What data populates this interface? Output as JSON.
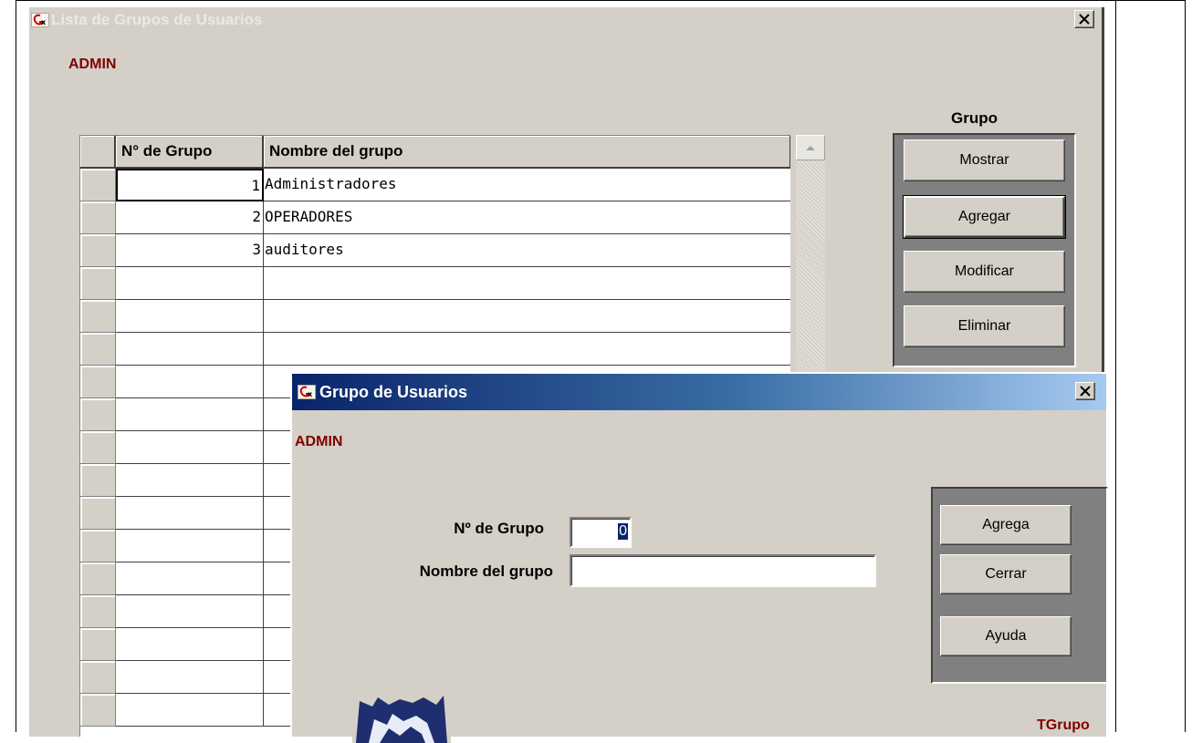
{
  "main_window": {
    "title": "Lista de Grupos de Usuarios",
    "user": "ADMIN",
    "close_label": "×"
  },
  "grid": {
    "columns": [
      "N° de Grupo",
      "Nombre del grupo"
    ],
    "rows": [
      {
        "num": "1",
        "name": "Administradores"
      },
      {
        "num": "2",
        "name": "OPERADORES"
      },
      {
        "num": "3",
        "name": "auditores"
      }
    ]
  },
  "grupo_panel": {
    "title": "Grupo",
    "buttons": [
      "Mostrar",
      "Agregar",
      "Modificar",
      "Eliminar"
    ]
  },
  "dialog": {
    "title": "Grupo de Usuarios",
    "user": "ADMIN",
    "fields": {
      "group_number_label": "Nº de Grupo",
      "group_number_value": "0",
      "group_name_label": "Nombre del grupo",
      "group_name_value": ""
    },
    "buttons": [
      "Agrega",
      "Cerrar",
      "Ayuda"
    ],
    "footer_tag": "TGrupo"
  },
  "icons": {
    "app_icon": "gx-app-icon",
    "close_icon": "close-icon",
    "scroll_up_icon": "scroll-up-arrow-icon"
  },
  "colors": {
    "window_bg": "#d4d0c8",
    "admin_text": "#800000",
    "dialog_title_gradient_start": "#0a246a",
    "dialog_title_gradient_end": "#a6caf0"
  }
}
